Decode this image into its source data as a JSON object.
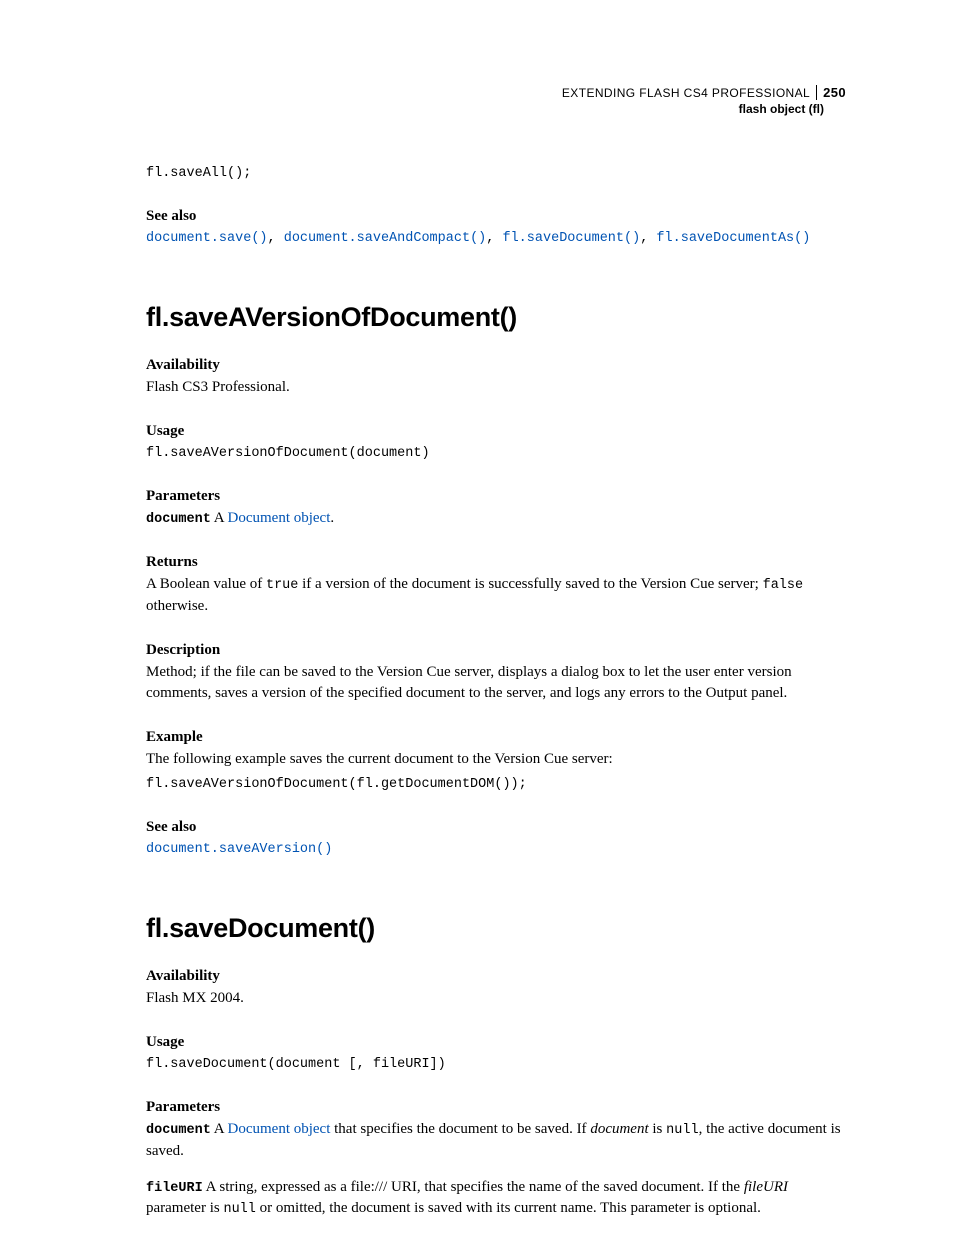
{
  "header": {
    "title": "EXTENDING FLASH CS4 PROFESSIONAL",
    "page_number": "250",
    "subtitle": "flash object (fl)"
  },
  "intro": {
    "code": "fl.saveAll();",
    "see_also_heading": "See also",
    "links": [
      "document.save()",
      "document.saveAndCompact()",
      "fl.saveDocument()",
      "fl.saveDocumentAs()"
    ]
  },
  "section1": {
    "title": "fl.saveAVersionOfDocument()",
    "availability_heading": "Availability",
    "availability_text": "Flash CS3 Professional.",
    "usage_heading": "Usage",
    "usage_code": "fl.saveAVersionOfDocument(document)",
    "parameters_heading": "Parameters",
    "param_name": "document",
    "param_intro": "  A ",
    "param_link": "Document object",
    "param_end": ".",
    "returns_heading": "Returns",
    "returns_pre": "A Boolean value of ",
    "returns_true": "true",
    "returns_mid": " if a version of the document is successfully saved to the Version Cue server; ",
    "returns_false": "false",
    "returns_end": " otherwise.",
    "description_heading": "Description",
    "description_text": "Method; if the file can be saved to the Version Cue server, displays a dialog box to let the user enter version comments, saves a version of the specified document to the server, and logs any errors to the Output panel.",
    "example_heading": "Example",
    "example_text": "The following example saves the current document to the Version Cue server:",
    "example_code": "fl.saveAVersionOfDocument(fl.getDocumentDOM());",
    "see_also_heading": "See also",
    "see_also_link": "document.saveAVersion()"
  },
  "section2": {
    "title": "fl.saveDocument()",
    "availability_heading": "Availability",
    "availability_text": "Flash MX 2004.",
    "usage_heading": "Usage",
    "usage_code": "fl.saveDocument(document [, fileURI])",
    "parameters_heading": "Parameters",
    "p1_name": "document",
    "p1_intro": "  A ",
    "p1_link": "Document object",
    "p1_mid": " that specifies the document to be saved. If ",
    "p1_italic": "document",
    "p1_mid2": " is ",
    "p1_null": "null",
    "p1_end": ", the active document is saved.",
    "p2_name": "fileURI",
    "p2_intro": "  A string, expressed as a file:/// URI, that specifies the name of the saved document. If the ",
    "p2_italic": "fileURI",
    "p2_mid": " parameter is ",
    "p2_null": "null",
    "p2_end": " or omitted, the document is saved with its current name. This parameter is optional."
  }
}
